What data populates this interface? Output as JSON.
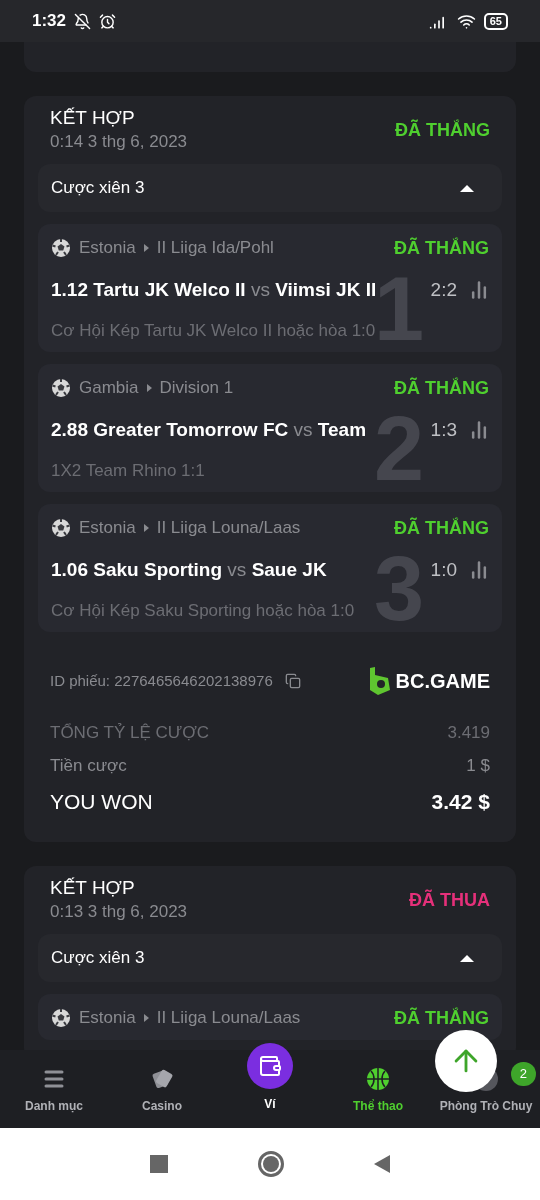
{
  "status_bar": {
    "time": "1:32",
    "battery": "65"
  },
  "bets": [
    {
      "title": "KẾT HỢP",
      "date": "0:14 3 thg 6, 2023",
      "result": {
        "text": "ĐÃ THẮNG",
        "kind": "won"
      },
      "parlay": {
        "label": "Cược xiên 3",
        "expanded": true
      },
      "legs": [
        {
          "country": "Estonia",
          "league": "II Liiga Ida/Pohl",
          "result": {
            "text": "ĐÃ THẮNG",
            "kind": "won"
          },
          "odds": "1.12",
          "home": "Tartu JK Welco II",
          "vs": "vs",
          "away": "Viimsi JK II",
          "score": "2:2",
          "market": "Cơ Hội Kép Tartu JK Welco II hoặc hòa",
          "market_score": "1:0",
          "index": "1"
        },
        {
          "country": "Gambia",
          "league": "Division 1",
          "result": {
            "text": "ĐÃ THẮNG",
            "kind": "won"
          },
          "odds": "2.88",
          "home": "Greater Tomorrow FC",
          "vs": "vs",
          "away": "Team",
          "score": "1:3",
          "market": "1X2 Team Rhino",
          "market_score": "1:1",
          "index": "2"
        },
        {
          "country": "Estonia",
          "league": "II Liiga Louna/Laas",
          "result": {
            "text": "ĐÃ THẮNG",
            "kind": "won"
          },
          "odds": "1.06",
          "home": "Saku Sporting",
          "vs": "vs",
          "away": "Saue JK",
          "score": "1:0",
          "market": "Cơ Hội Kép Saku Sporting hoặc hòa",
          "market_score": "1:0",
          "index": "3"
        }
      ],
      "ticket": {
        "label": "ID phiếu:",
        "id": "2276465646202138976"
      },
      "brand": "BC.GAME",
      "summary": [
        {
          "kind": "odds",
          "label": "TỔNG TỶ LỆ CƯỢC",
          "value": "3.419"
        },
        {
          "kind": "stake",
          "label": "Tiền cược",
          "value": "1 $"
        },
        {
          "kind": "payout",
          "label": "YOU WON",
          "value": "3.42 $"
        }
      ]
    },
    {
      "title": "KẾT HỢP",
      "date": "0:13 3 thg 6, 2023",
      "result": {
        "text": "ĐÃ THUA",
        "kind": "lost"
      },
      "parlay": {
        "label": "Cược xiên 3",
        "expanded": true
      },
      "legs": [
        {
          "country": "Estonia",
          "league": "II Liiga Louna/Laas",
          "result": {
            "text": "ĐÃ THẮNG",
            "kind": "won"
          }
        }
      ]
    }
  ],
  "nav": [
    {
      "kind": "menu",
      "label": "Danh mục",
      "selected": false
    },
    {
      "kind": "casino",
      "label": "Casino",
      "selected": false
    },
    {
      "kind": "wallet",
      "label": "Ví",
      "selected": false
    },
    {
      "kind": "sports",
      "label": "Thể thao",
      "selected": true
    },
    {
      "kind": "chat",
      "label": "Phòng Trò Chuy",
      "selected": false,
      "badge": "2"
    }
  ]
}
